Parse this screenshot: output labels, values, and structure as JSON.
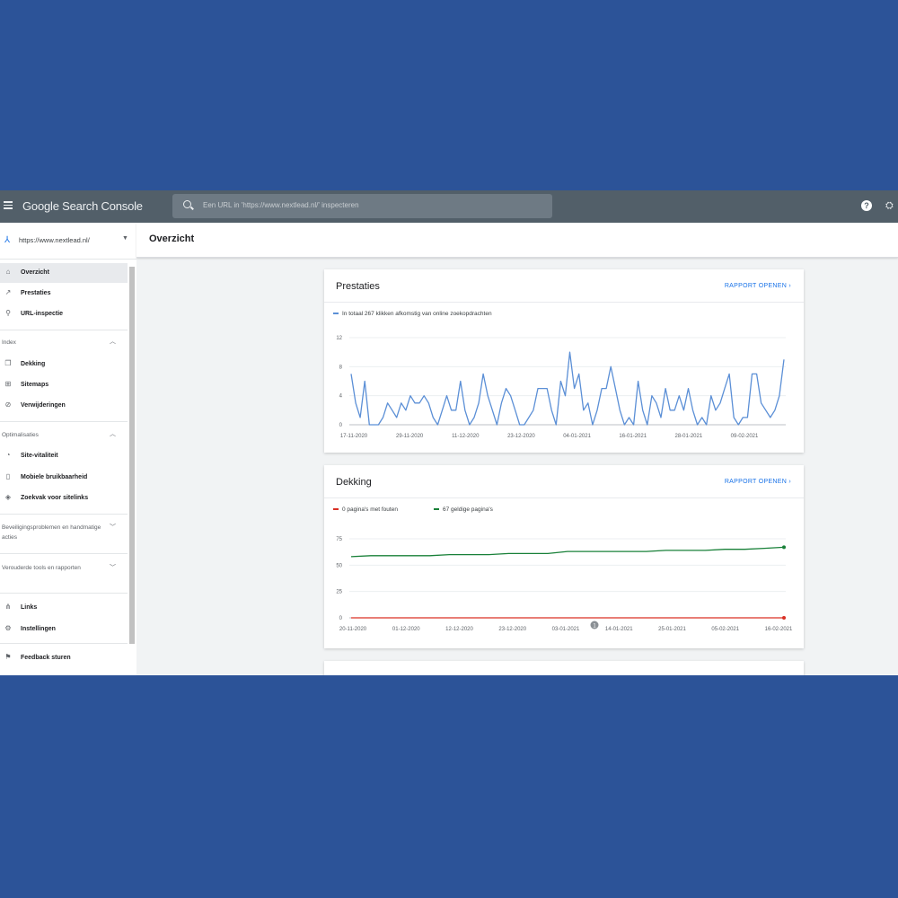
{
  "app": {
    "title": "Google Search Console",
    "help_glyph": "?",
    "user_glyph": "⛭"
  },
  "search": {
    "placeholder": "Een URL in 'https://www.nextlead.nl/' inspecteren"
  },
  "property": {
    "url": "https://www.nextlead.nl/"
  },
  "page": {
    "title": "Overzicht"
  },
  "sidebar": {
    "items": [
      {
        "label": "Overzicht",
        "icon": "home-icon"
      },
      {
        "label": "Prestaties",
        "icon": "trending-up-icon"
      },
      {
        "label": "URL-inspectie",
        "icon": "search-icon"
      },
      {
        "label": "Dekking",
        "icon": "file-copy-icon"
      },
      {
        "label": "Sitemaps",
        "icon": "sitemap-icon"
      },
      {
        "label": "Verwijderingen",
        "icon": "eye-off-icon"
      },
      {
        "label": "Site-vitaliteit",
        "icon": "speed-icon"
      },
      {
        "label": "Mobiele bruikbaarheid",
        "icon": "phone-icon"
      },
      {
        "label": "Zoekvak voor sitelinks",
        "icon": "diamond-icon"
      },
      {
        "label": "Links",
        "icon": "links-icon"
      },
      {
        "label": "Instellingen",
        "icon": "gear-icon"
      },
      {
        "label": "Feedback sturen",
        "icon": "feedback-icon"
      }
    ],
    "sections": [
      {
        "label": "Index"
      },
      {
        "label": "Optimalisaties"
      },
      {
        "label": "Beveiligingsproblemen en handmatige acties"
      },
      {
        "label": "Verouderde tools en rapporten"
      }
    ]
  },
  "cards": {
    "prestaties": {
      "title": "Prestaties",
      "link": "RAPPORT OPENEN",
      "legend": "In totaal 267 klikken afkomstig van online zoekopdrachten"
    },
    "dekking": {
      "title": "Dekking",
      "link": "RAPPORT OPENEN",
      "legend_errors": "0 pagina's met fouten",
      "legend_valid": "67 geldige pagina's",
      "marker": "1"
    }
  },
  "colors": {
    "accent": "#1a73e8",
    "clicks": "#5b8fd6",
    "errors": "#d93025",
    "valid": "#188038",
    "topbar": "#525f69"
  },
  "chart_data": [
    {
      "type": "line",
      "title": "Prestaties",
      "tick_labels": [
        "17-11-2020",
        "29-11-2020",
        "11-12-2020",
        "23-12-2020",
        "04-01-2021",
        "16-01-2021",
        "28-01-2021",
        "09-02-2021"
      ],
      "y_ticks": [
        "0",
        "4",
        "8",
        "12"
      ],
      "ylim": [
        0,
        12
      ],
      "x": [
        "2020-11-17",
        "2020-11-18",
        "2020-11-19",
        "2020-11-20",
        "2020-11-21",
        "2020-11-22",
        "2020-11-23",
        "2020-11-24",
        "2020-11-25",
        "2020-11-26",
        "2020-11-27",
        "2020-11-28",
        "2020-11-29",
        "2020-11-30",
        "2020-12-01",
        "2020-12-02",
        "2020-12-03",
        "2020-12-04",
        "2020-12-05",
        "2020-12-06",
        "2020-12-07",
        "2020-12-08",
        "2020-12-09",
        "2020-12-10",
        "2020-12-11",
        "2020-12-12",
        "2020-12-13",
        "2020-12-14",
        "2020-12-15",
        "2020-12-16",
        "2020-12-17",
        "2020-12-18",
        "2020-12-19",
        "2020-12-20",
        "2020-12-21",
        "2020-12-22",
        "2020-12-23",
        "2020-12-24",
        "2020-12-25",
        "2020-12-26",
        "2020-12-27",
        "2020-12-28",
        "2020-12-29",
        "2020-12-30",
        "2020-12-31",
        "2021-01-01",
        "2021-01-02",
        "2021-01-03",
        "2021-01-04",
        "2021-01-05",
        "2021-01-06",
        "2021-01-07",
        "2021-01-08",
        "2021-01-09",
        "2021-01-10",
        "2021-01-11",
        "2021-01-12",
        "2021-01-13",
        "2021-01-14",
        "2021-01-15",
        "2021-01-16",
        "2021-01-17",
        "2021-01-18",
        "2021-01-19",
        "2021-01-20",
        "2021-01-21",
        "2021-01-22",
        "2021-01-23",
        "2021-01-24",
        "2021-01-25",
        "2021-01-26",
        "2021-01-27",
        "2021-01-28",
        "2021-01-29",
        "2021-01-30",
        "2021-01-31",
        "2021-02-01",
        "2021-02-02",
        "2021-02-03",
        "2021-02-04",
        "2021-02-05",
        "2021-02-06",
        "2021-02-07",
        "2021-02-08",
        "2021-02-09",
        "2021-02-10",
        "2021-02-11",
        "2021-02-12",
        "2021-02-13",
        "2021-02-14",
        "2021-02-15",
        "2021-02-16",
        "2021-02-17",
        "2021-02-18",
        "2021-02-19",
        "2021-02-20"
      ],
      "series": [
        {
          "values": [
            7,
            3,
            1,
            6,
            0,
            0,
            0,
            1,
            3,
            2,
            1,
            3,
            2,
            4,
            3,
            3,
            4,
            3,
            1,
            0,
            2,
            4,
            2,
            2,
            6,
            2,
            0,
            1,
            3,
            7,
            4,
            2,
            0,
            3,
            5,
            4,
            2,
            0,
            0,
            1,
            2,
            5,
            5,
            5,
            2,
            0,
            6,
            4,
            10,
            5,
            7,
            2,
            3,
            0,
            2,
            5,
            5,
            8,
            5,
            2,
            0,
            1,
            0,
            6,
            2,
            0,
            4,
            3,
            1,
            5,
            2,
            2,
            4,
            2,
            5,
            2,
            0,
            1,
            0,
            4,
            2,
            3,
            5,
            7,
            1,
            0,
            1,
            1,
            7,
            7,
            3,
            2,
            1,
            2,
            4,
            9
          ]
        }
      ]
    },
    {
      "type": "line",
      "title": "Dekking",
      "tick_labels": [
        "20-11-2020",
        "01-12-2020",
        "12-12-2020",
        "23-12-2020",
        "03-01-2021",
        "14-01-2021",
        "25-01-2021",
        "05-02-2021",
        "16-02-2021"
      ],
      "y_ticks": [
        "0",
        "25",
        "50",
        "75"
      ],
      "ylim": [
        0,
        75
      ],
      "x": [
        "2020-11-20",
        "2020-11-24",
        "2020-11-28",
        "2020-12-02",
        "2020-12-06",
        "2020-12-10",
        "2020-12-14",
        "2020-12-18",
        "2020-12-22",
        "2020-12-26",
        "2020-12-30",
        "2021-01-03",
        "2021-01-07",
        "2021-01-11",
        "2021-01-15",
        "2021-01-19",
        "2021-01-23",
        "2021-01-27",
        "2021-01-31",
        "2021-02-04",
        "2021-02-08",
        "2021-02-12",
        "2021-02-16"
      ],
      "series": [
        {
          "name": "0 pagina's met fouten",
          "values": [
            0,
            0,
            0,
            0,
            0,
            0,
            0,
            0,
            0,
            0,
            0,
            0,
            0,
            0,
            0,
            0,
            0,
            0,
            0,
            0,
            0,
            0,
            0
          ]
        },
        {
          "name": "67 geldige pagina's",
          "values": [
            58,
            59,
            59,
            59,
            59,
            60,
            60,
            60,
            61,
            61,
            61,
            63,
            63,
            63,
            63,
            63,
            64,
            64,
            64,
            65,
            65,
            66,
            67
          ]
        }
      ]
    }
  ]
}
